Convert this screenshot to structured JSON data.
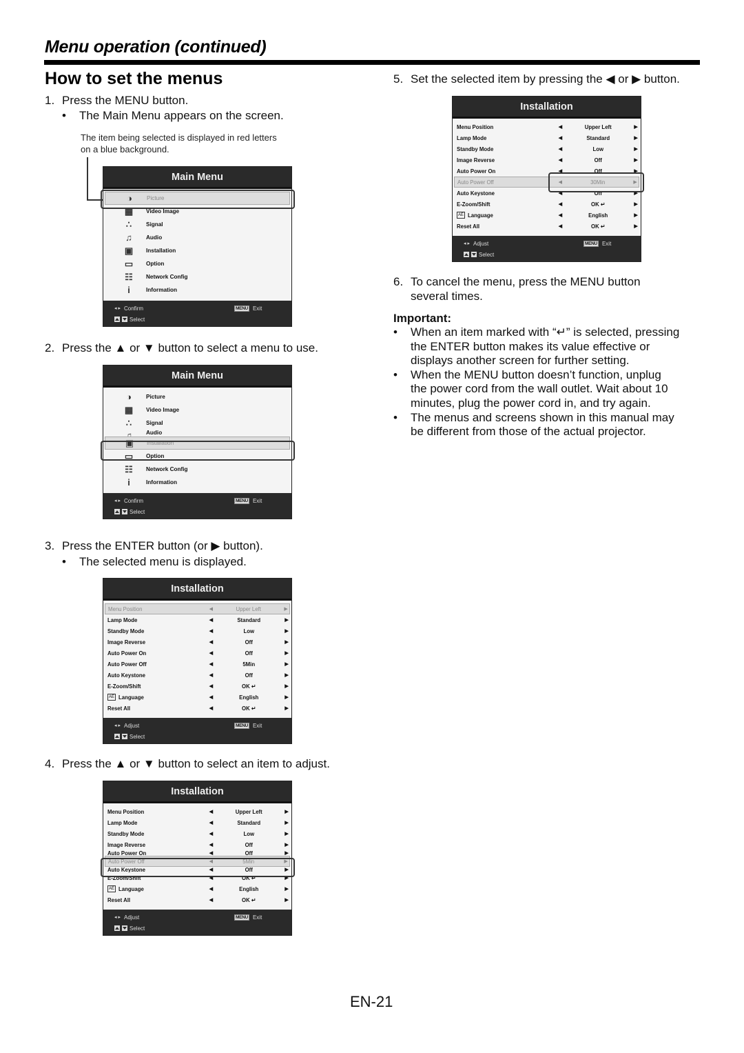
{
  "section_title": "Menu operation (continued)",
  "page_heading": "How to set the menus",
  "steps": {
    "s1": {
      "num": "1.",
      "text": "Press the MENU button.",
      "bullet": "The Main Menu appears on the screen."
    },
    "note": {
      "line1": "The item being selected is displayed in red letters",
      "line2": "on a blue background."
    },
    "s2": {
      "num": "2.",
      "text": "Press the  ▲ or ▼ button to select a menu to use."
    },
    "s3": {
      "num": "3.",
      "text": "Press the ENTER button (or ▶ button).",
      "bullet": "The selected menu is displayed."
    },
    "s4": {
      "num": "4.",
      "text": "Press the ▲ or ▼ button to select an item to adjust."
    },
    "s5": {
      "num": "5.",
      "text": "Set the selected item by pressing the ◀ or ▶ button."
    },
    "s6": {
      "num": "6.",
      "line1": "To cancel the menu, press the MENU button",
      "line2": "several times."
    }
  },
  "important": {
    "heading": "Important:",
    "bullets": [
      [
        "When an item marked with “↵” is selected, pressing",
        "the ENTER button makes its value effective or",
        "displays another screen for further setting."
      ],
      [
        "When the MENU button doesn’t function, unplug",
        "the power cord from the wall outlet. Wait about 10",
        "minutes, plug the power cord in, and try again."
      ],
      [
        "The menus and screens shown in this manual may",
        "be different from those of the actual projector."
      ]
    ]
  },
  "main_menu": {
    "title": "Main Menu",
    "items": [
      {
        "label": "Picture",
        "icon": "picture-icon",
        "glyph": "◑"
      },
      {
        "label": "Video Image",
        "icon": "video-image-icon",
        "glyph": "▦"
      },
      {
        "label": "Signal",
        "icon": "signal-icon",
        "glyph": "∴"
      },
      {
        "label": "Audio",
        "icon": "audio-icon",
        "glyph": "♫"
      },
      {
        "label": "Installation",
        "icon": "installation-icon",
        "glyph": "▣"
      },
      {
        "label": "Option",
        "icon": "option-icon",
        "glyph": "▭"
      },
      {
        "label": "Network Config",
        "icon": "network-config-icon",
        "glyph": "☷"
      },
      {
        "label": "Information",
        "icon": "information-icon",
        "glyph": "i"
      }
    ],
    "footer": {
      "confirm": "Confirm",
      "select": "Select",
      "menu_key": "MENU",
      "exit": "Exit",
      "lr": "◂ ▸"
    }
  },
  "installation_menu": {
    "title": "Installation",
    "items": [
      {
        "label": "Menu Position",
        "value": "Upper Left"
      },
      {
        "label": "Lamp Mode",
        "value": "Standard"
      },
      {
        "label": "Standby Mode",
        "value": "Low"
      },
      {
        "label": "Image Reverse",
        "value": "Off"
      },
      {
        "label": "Auto Power On",
        "value": "Off"
      },
      {
        "label": "Auto Power Off",
        "value": "5Min"
      },
      {
        "label": "Auto Keystone",
        "value": "Off"
      },
      {
        "label": "E-Zoom/Shift",
        "value": "OK ↵"
      },
      {
        "label": "Language",
        "value": "English",
        "icon_text": "AÉ"
      },
      {
        "label": "Reset All",
        "value": "OK ↵"
      }
    ],
    "adjusted_value": "30Min",
    "footer": {
      "adjust": "Adjust",
      "select": "Select",
      "menu_key": "MENU",
      "exit": "Exit",
      "lr": "◂ ▸"
    },
    "arrow_left": "◀",
    "arrow_right": "▶"
  },
  "page_number": "EN-21"
}
